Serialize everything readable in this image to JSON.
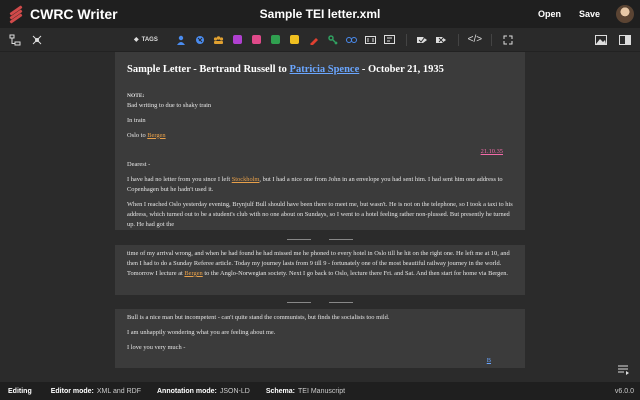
{
  "app": {
    "name": "CWRC Writer",
    "doc_title": "Sample TEI letter.xml",
    "open_label": "Open",
    "save_label": "Save"
  },
  "toolbar": {
    "tags_label": "TAGS",
    "left_icons": [
      "structure-tree-icon",
      "entities-icon"
    ],
    "entity_icons": [
      {
        "name": "person-icon",
        "color": "#4a8cf0"
      },
      {
        "name": "place-icon",
        "color": "#4a8cf0"
      },
      {
        "name": "organization-icon",
        "color": "#e0a030"
      },
      {
        "name": "title-icon",
        "color": "#b040d0"
      },
      {
        "name": "date-icon",
        "color": "#e04a8a"
      },
      {
        "name": "citation-icon",
        "color": "#30a050"
      },
      {
        "name": "note-icon",
        "color": "#f0c020"
      },
      {
        "name": "correction-icon",
        "color": "#e04030"
      },
      {
        "name": "keyword-icon",
        "color": "#30a060"
      },
      {
        "name": "link-icon",
        "color": "#4a8cf0"
      },
      {
        "name": "translate-icon",
        "color": "#4a8cf0"
      },
      {
        "name": "tag-icon",
        "color": "#dddddd"
      }
    ],
    "right_icons": [
      "image-viewer-icon",
      "layout-icon"
    ]
  },
  "document": {
    "heading_prefix": "Sample Letter - Bertrand Russell to ",
    "heading_person": "Patricia Spence",
    "heading_suffix": " - October 21, 1935",
    "note_label": "NOTE:",
    "note_text": "Bad writing to due to shaky train",
    "line_in_train": "In train",
    "line_oslo_prefix": "Oslo to ",
    "line_oslo_place": "Bergen",
    "date": "21.10.35",
    "salutation": "Dearest -",
    "p1_a": "I have had no letter from you since I left ",
    "p1_place": "Stockholm",
    "p1_b": ", but I had a nice one from John in an envelope you had sent him. I had sent him one address to Copenhagen but he hadn't used it.",
    "p2": "When I reached Oslo yesterday evening, Brynjulf Bull should have been there to meet me, but wasn't. He is not on the telephone, so I took a taxi to his address, which turned out to be a student's club with no one about on Sundays, so I went to a hotel feeling rather non-plussed. But presently he turned up. He had got the",
    "p3_a": "time of my arrival wrong, and when he had found he had missed me he phoned to every hotel in Oslo till he hit on the right one. He left me at 10, and then I had to do a Sunday Referee article. Today my journey lasts from 9 till 9 - fortunately one of the most beautiful railway journey in the world. Tomorrow I lecture at ",
    "p3_place": "Bergen",
    "p3_b": " to the Anglo-Norwegian society. Next I go back to Oslo, lecture there Fri. and Sat. And then start for home via Bergen.",
    "p4": "Bull is a nice man but incompetent - can't quite stand the communists, but finds the socialists too mild.",
    "p5": "I am unhappily wondering what you are feeling about me.",
    "p6": "I love you very much -",
    "signature": "B"
  },
  "status": {
    "mode": "Editing",
    "editor_mode_label": "Editor mode:",
    "editor_mode_value": "XML and RDF",
    "annotation_mode_label": "Annotation mode:",
    "annotation_mode_value": "JSON-LD",
    "schema_label": "Schema:",
    "schema_value": "TEI Manuscript",
    "version": "v6.0.0"
  }
}
